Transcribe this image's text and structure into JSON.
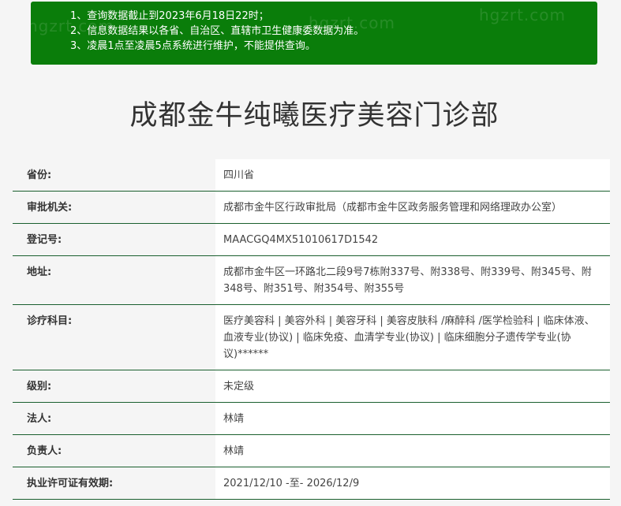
{
  "notice": {
    "watermark": "hgzrt.com",
    "lines": [
      "1、查询数据截止到2023年6月18日22时；",
      "2、信息数据结果以各省、自治区、直辖市卫生健康委数据为准。",
      "3、凌晨1点至凌晨5点系统进行维护，不能提供查询。"
    ],
    "bg_color": "#0a7d0a"
  },
  "title": "成都金牛纯曦医疗美容门诊部",
  "fields": [
    {
      "label": "省份:",
      "value": "四川省"
    },
    {
      "label": "审批机关:",
      "value": "成都市金牛区行政审批局（成都市金牛区政务服务管理和网络理政办公室）"
    },
    {
      "label": "登记号:",
      "value": "MAACGQ4MX51010617D1542"
    },
    {
      "label": "地址:",
      "value": "成都市金牛区一环路北二段9号7栋附337号、附338号、附339号、附345号、附348号、附351号、附354号、附355号"
    },
    {
      "label": "诊疗科目:",
      "value": "医疗美容科 | 美容外科 | 美容牙科 | 美容皮肤科 /麻醉科 /医学检验科 | 临床体液、血液专业(协议) | 临床免疫、血清学专业(协议) | 临床细胞分子遗传学专业(协议)******"
    },
    {
      "label": "级别:",
      "value": "未定级"
    },
    {
      "label": "法人:",
      "value": "林靖"
    },
    {
      "label": "负责人:",
      "value": "林靖"
    },
    {
      "label": "执业许可证有效期:",
      "value": "2021/12/10 -至- 2026/12/9"
    }
  ]
}
